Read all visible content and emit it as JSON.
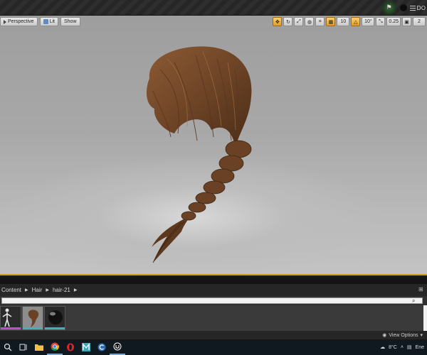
{
  "viewport": {
    "perspective_label": "Perspective",
    "lit_label": "Lit",
    "show_label": "Show",
    "grid_snap_value": "10",
    "rotation_snap_value": "10°",
    "scale_snap_value": "0.25",
    "camera_speed_value": "2"
  },
  "breadcrumb": {
    "items": [
      "Content",
      "Hair",
      "hair-21"
    ]
  },
  "assets": {
    "thumbnails": [
      {
        "name": "character-mannequin",
        "strip_color": "#c04fc0"
      },
      {
        "name": "hair-braid",
        "strip_color": "#37b6b6"
      },
      {
        "name": "hair-material-sphere",
        "strip_color": "#37b6b6"
      }
    ]
  },
  "content_browser": {
    "view_options_label": "View Options"
  },
  "taskbar": {
    "weather_text": "8°C",
    "tray_text": "Ene"
  },
  "colors": {
    "viewport_border": "#c89b20",
    "active_button": "#e19c2a",
    "taskbar": "#101820"
  }
}
